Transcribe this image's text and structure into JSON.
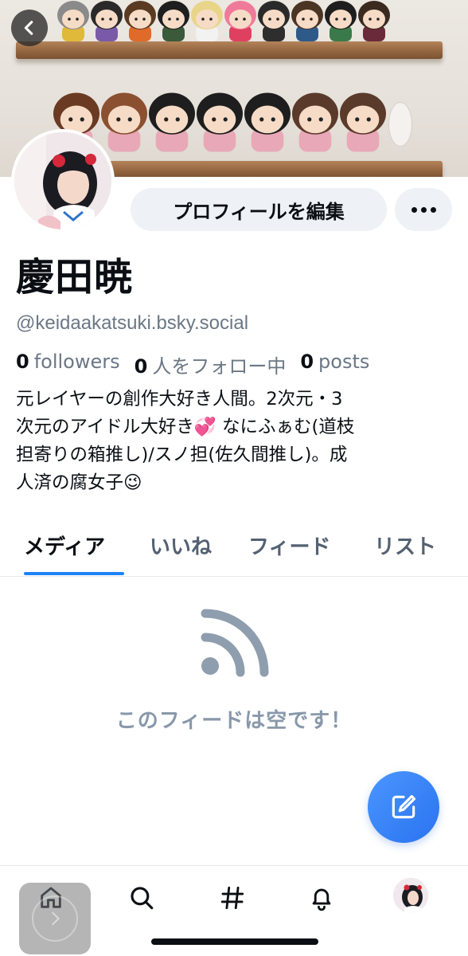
{
  "profile": {
    "display_name": "慶田暁",
    "handle": "@keidaakatsuki.bsky.social",
    "bio": "元レイヤーの創作大好き人間。2次元・3\n次元のアイドル大好き💞 なにふぁむ(道枝\n担寄りの箱推し)/スノ担(佐久間推し)。成\n人済の腐女子😉"
  },
  "header": {
    "edit_profile_label": "プロフィールを編集",
    "more_icon": "ellipsis-icon",
    "back_icon": "chevron-left-icon"
  },
  "stats": {
    "followers_count": "0",
    "followers_label": "followers",
    "following_count": "0",
    "following_label": "人をフォロー中",
    "posts_count": "0",
    "posts_label": "posts"
  },
  "tabs": [
    {
      "label": "メディア",
      "active": true
    },
    {
      "label": "いいね",
      "active": false
    },
    {
      "label": "フィード",
      "active": false
    },
    {
      "label": "リスト",
      "active": false
    }
  ],
  "empty_state": {
    "icon": "feed-icon",
    "message": "このフィードは空です！"
  },
  "fab": {
    "icon": "compose-icon"
  },
  "bottom_nav": {
    "items": [
      {
        "icon": "home-icon"
      },
      {
        "icon": "search-icon"
      },
      {
        "icon": "hashtag-icon"
      },
      {
        "icon": "bell-icon"
      },
      {
        "icon": "avatar"
      }
    ]
  },
  "colors": {
    "accent": "#1d83f5",
    "fab": "#3b82f6",
    "muted_text": "#6b7785",
    "button_bg": "#eef1f5"
  }
}
